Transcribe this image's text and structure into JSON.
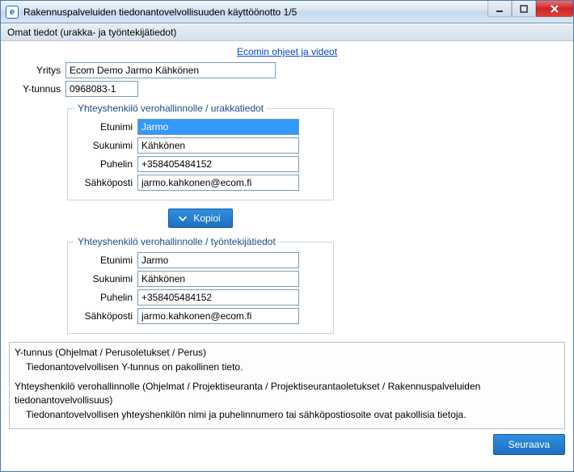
{
  "window": {
    "title": "Rakennuspalveluiden tiedonantovelvollisuuden käyttöönotto 1/5"
  },
  "section": {
    "header": "Omat tiedot (urakka- ja työntekijätiedot)"
  },
  "help": {
    "link_text": "Ecomin ohjeet ja videot"
  },
  "company": {
    "label": "Yritys",
    "value": "Ecom Demo Jarmo Kähkönen",
    "ytunnus_label": "Y-tunnus",
    "ytunnus_value": "0968083-1"
  },
  "group1": {
    "legend": "Yhteyshenkilö verohallinnolle / urakkatiedot",
    "firstname_label": "Etunimi",
    "firstname_value": "Jarmo",
    "lastname_label": "Sukunimi",
    "lastname_value": "Kähkönen",
    "phone_label": "Puhelin",
    "phone_value": "+358405484152",
    "email_label": "Sähköposti",
    "email_value": "jarmo.kahkonen@ecom.fi"
  },
  "copy": {
    "label": "Kopioi"
  },
  "group2": {
    "legend": "Yhteyshenkilö verohallinnolle / työntekijätiedot",
    "firstname_label": "Etunimi",
    "firstname_value": "Jarmo",
    "lastname_label": "Sukunimi",
    "lastname_value": "Kähkönen",
    "phone_label": "Puhelin",
    "phone_value": "+358405484152",
    "email_label": "Sähköposti",
    "email_value": "jarmo.kahkonen@ecom.fi"
  },
  "info": {
    "line1": "Y-tunnus (Ohjelmat / Perusoletukset / Perus)",
    "line2": "Tiedonantovelvollisen Y-tunnus on pakollinen tieto.",
    "line3": "Yhteyshenkilö verohallinnolle (Ohjelmat / Projektiseuranta / Projektiseurantaoletukset / Rakennuspalveluiden tiedonantovelvollisuus)",
    "line4": "Tiedonantovelvollisen yhteyshenkilön nimi ja puhelinnumero tai sähköpostiosoite ovat pakollisia tietoja."
  },
  "footer": {
    "next_label": "Seuraava"
  }
}
